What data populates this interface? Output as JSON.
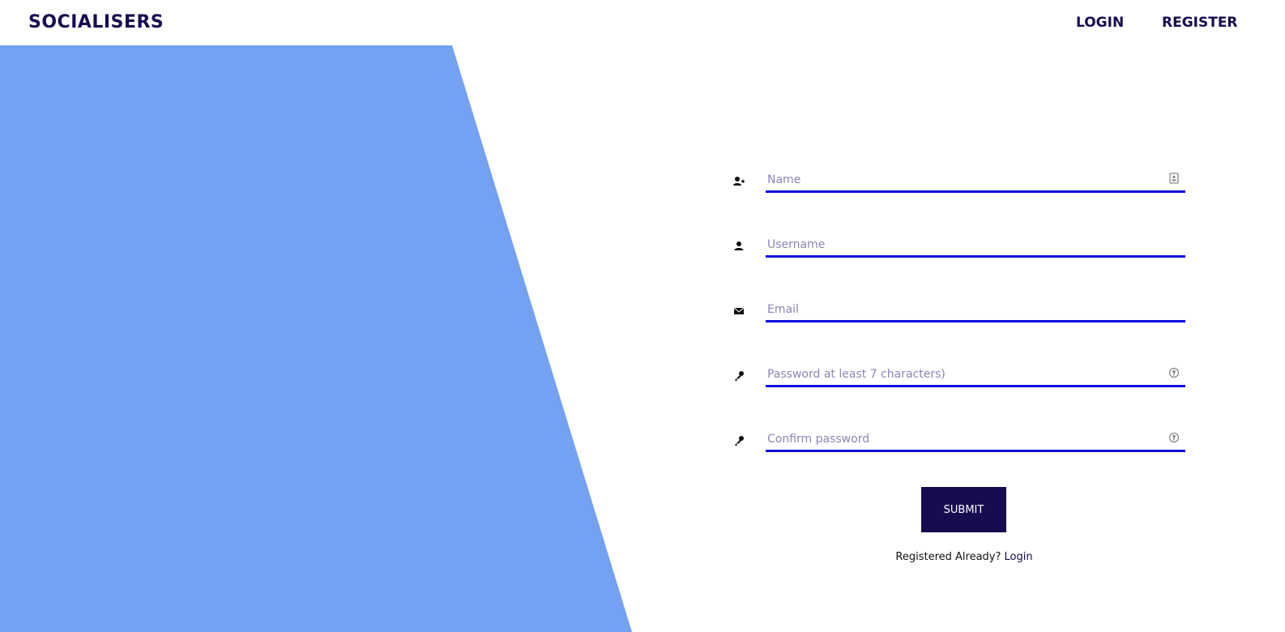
{
  "brand": "SOCIALISERS",
  "nav": {
    "login": "LOGIN",
    "register": "REGISTER"
  },
  "form": {
    "name_placeholder": "Name",
    "username_placeholder": "Username",
    "email_placeholder": "Email",
    "password_placeholder": "Password at least 7 characters)",
    "confirm_placeholder": "Confirm password",
    "submit_label": "SUBMIT",
    "registered_text": "Registered Already?",
    "login_link": "Login"
  },
  "colors": {
    "brand": "#150d4f",
    "accent_panel": "#74a1f1",
    "input_underline": "#1010e0"
  },
  "icons": {
    "name": "user-plus-icon",
    "username": "user-icon",
    "email": "envelope-icon",
    "password": "key-icon",
    "confirm": "key-icon",
    "name_trailing": "contact-card-icon",
    "password_trailing": "key-badge-icon"
  }
}
